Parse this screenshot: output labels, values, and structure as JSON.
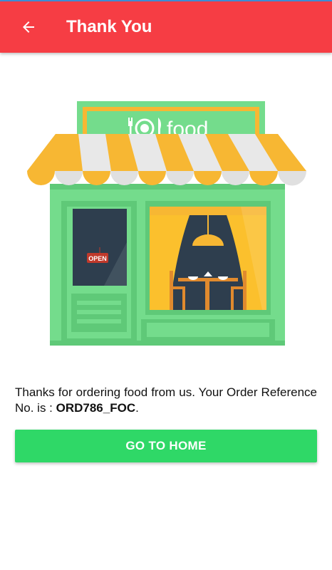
{
  "appbar": {
    "title": "Thank You",
    "back_icon": "arrow-left-icon",
    "color": "#f63d44"
  },
  "illustration": {
    "sign_text": "food",
    "door_sign": "OPEN",
    "colors": {
      "wall": "#74dc8c",
      "awning_yellow": "#f7b733",
      "awning_white": "#e8e8e8",
      "door": "#2e3e4e",
      "window_curtain": "#fbc02d"
    }
  },
  "message": {
    "text_prefix": "Thanks for ordering food from us. Your Order Reference No. is : ",
    "order_ref": "ORD786_FOC",
    "text_suffix": "."
  },
  "home_button": {
    "label": "GO TO HOME",
    "color": "#2fd867"
  }
}
